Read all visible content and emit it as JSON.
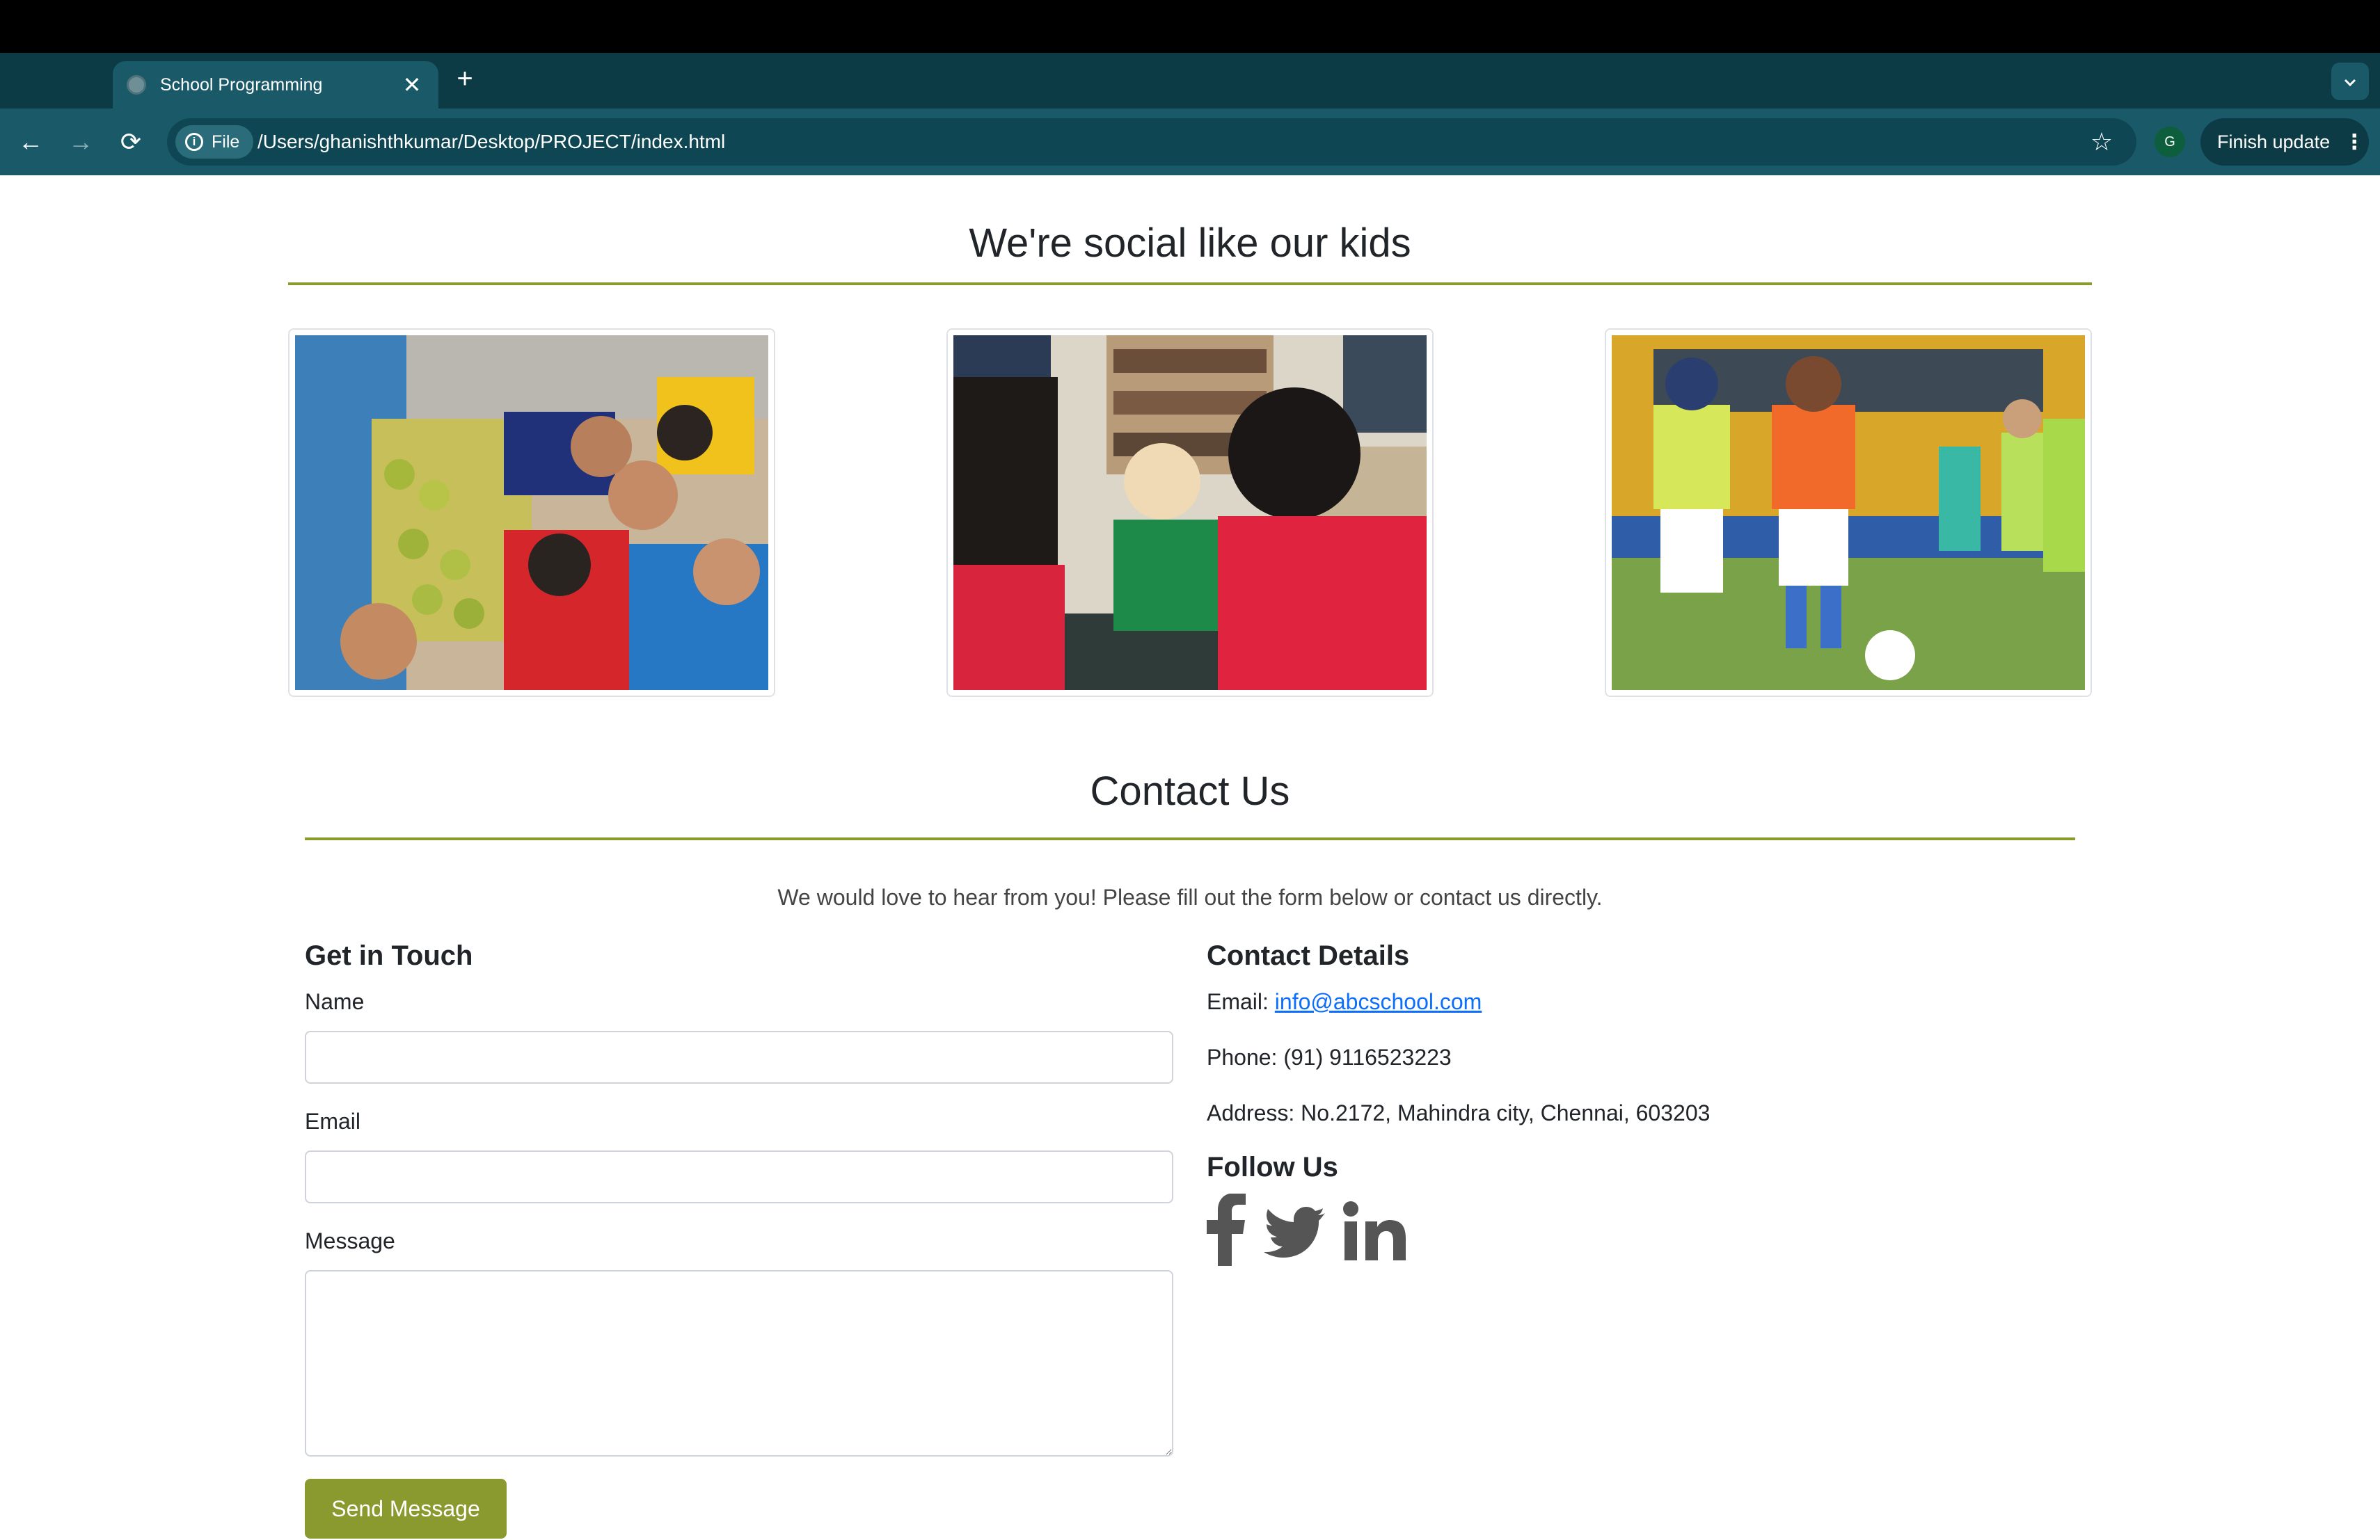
{
  "browser": {
    "tab_title": "School Programming",
    "tab_close": "✕",
    "new_tab": "+",
    "tab_search_icon": "chevron-down-icon",
    "back_icon": "←",
    "forward_icon": "→",
    "reload_icon": "⟳",
    "site_chip_label": "File",
    "url": "/Users/ghanishthkumar/Desktop/PROJECT/index.html",
    "bookmark_icon": "☆",
    "profile_initial": "G",
    "update_label": "Finish update",
    "menu_icon": "⋮"
  },
  "social_section": {
    "title": "We're social like our kids",
    "photos": [
      {
        "subject": "students-fruit-activity-photo"
      },
      {
        "subject": "library-conversation-photo"
      },
      {
        "subject": "students-football-photo"
      }
    ]
  },
  "contact_section": {
    "title": "Contact Us",
    "intro": "We would love to hear from you! Please fill out the form below or contact us directly.",
    "form": {
      "heading": "Get in Touch",
      "name_label": "Name",
      "name_value": "",
      "email_label": "Email",
      "email_value": "",
      "message_label": "Message",
      "message_value": "",
      "submit_label": "Send Message"
    },
    "details": {
      "heading": "Contact Details",
      "email_prefix": "Email: ",
      "email": "info@abcschool.com",
      "phone": "Phone: (91) 9116523223",
      "address": "Address: No.2172, Mahindra city, Chennai, 603203"
    },
    "follow": {
      "heading": "Follow Us",
      "icons": [
        "facebook-icon",
        "twitter-icon",
        "linkedin-icon"
      ]
    }
  },
  "colors": {
    "chrome_dark": "#0c3b46",
    "chrome_toolbar": "#1a5a68",
    "accent_olive": "#8a9a2e",
    "link_blue": "#0d6efd",
    "social_icon_gray": "#555555"
  }
}
